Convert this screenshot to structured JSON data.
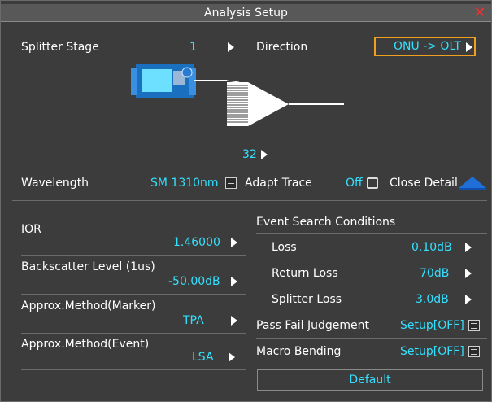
{
  "window": {
    "title": "Analysis Setup",
    "close_glyph": "✕"
  },
  "splitter": {
    "label": "Splitter Stage",
    "value": "1",
    "ratio": "32"
  },
  "direction": {
    "label": "Direction",
    "value": "ONU -> OLT"
  },
  "wavelength": {
    "label": "Wavelength",
    "value": "SM 1310nm"
  },
  "adapt_trace": {
    "label": "Adapt Trace",
    "value": "Off"
  },
  "close_detail": {
    "label": "Close Detail"
  },
  "ior": {
    "label": "IOR",
    "value": "1.46000"
  },
  "backscatter": {
    "label": "Backscatter Level (1us)",
    "value": "-50.00dB"
  },
  "approx_marker": {
    "label": "Approx.Method(Marker)",
    "value": "TPA"
  },
  "approx_event": {
    "label": "Approx.Method(Event)",
    "value": "LSA"
  },
  "event_search": {
    "title": "Event Search Conditions",
    "items": [
      {
        "label": "Loss",
        "value": "0.10dB"
      },
      {
        "label": "Return Loss",
        "value": "70dB"
      },
      {
        "label": "Splitter Loss",
        "value": "3.0dB"
      }
    ]
  },
  "pass_fail": {
    "label": "Pass Fail Judgement",
    "value": "Setup[OFF]"
  },
  "macro_bending": {
    "label": "Macro Bending",
    "value": "Setup[OFF]"
  },
  "default_button": {
    "label": "Default"
  },
  "colors": {
    "accent_value": "#33e0ff",
    "highlight_border": "#f0a020",
    "close_red": "#ff2a2a",
    "panel_bg": "#3c3c3c"
  },
  "icons": [
    "close-icon",
    "arrow-right-icon",
    "list-icon",
    "checkbox-icon",
    "collapse-triangle-icon",
    "otdr-device-icon",
    "splitter-icon"
  ]
}
